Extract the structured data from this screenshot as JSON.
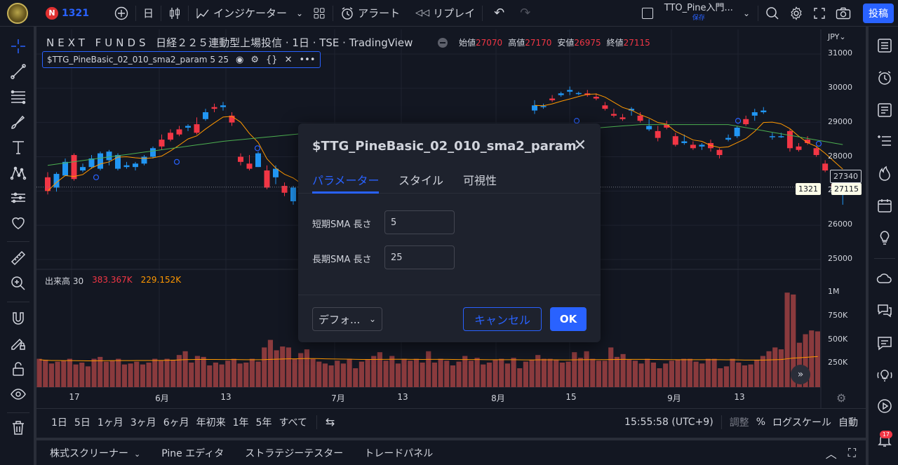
{
  "topbar": {
    "symbol": "1321",
    "interval": "日",
    "indicators_label": "インジケーター",
    "alert_label": "アラート",
    "replay_label": "リプレイ",
    "layout_name": "TTO_Pine入門...",
    "layout_status": "保存",
    "post_label": "投稿"
  },
  "chart": {
    "title_prefix": "NEXT FUNDS",
    "title_rest": "日経２２５連動型上場投信 · 1日 · TSE · TradingView",
    "ohlc": [
      {
        "k": "始値",
        "v": "27070"
      },
      {
        "k": "高値",
        "v": "27170"
      },
      {
        "k": "安値",
        "v": "26975"
      },
      {
        "k": "終値",
        "v": "27115"
      }
    ],
    "indicator_legend": "$TTG_PineBasic_02_010_sma2_param 5 25",
    "currency": "JPY",
    "price_ticks": [
      "31000",
      "30000",
      "29000",
      "28000",
      "27000",
      "26000",
      "25000"
    ],
    "volume_ticks": [
      "1M",
      "750K",
      "500K",
      "250K"
    ],
    "time_ticks": [
      "17",
      "6月",
      "13",
      "7月",
      "13",
      "8月",
      "15",
      "9月",
      "13"
    ],
    "price_label_sma": "27340",
    "price_label_last": "27115",
    "symbol_tag": "1321",
    "volume_legend": {
      "name": "出来高 30",
      "v1": "383.367K",
      "v2": "229.152K"
    }
  },
  "dialog": {
    "title": "$TTG_PineBasic_02_010_sma2_param",
    "tabs": [
      "パラメーター",
      "スタイル",
      "可視性"
    ],
    "active_tab": 0,
    "params": [
      {
        "label": "短期SMA 長さ",
        "value": "5"
      },
      {
        "label": "長期SMA 長さ",
        "value": "25"
      }
    ],
    "defaults_label": "デフォ...",
    "cancel_label": "キャンセル",
    "ok_label": "OK"
  },
  "time_range": {
    "items": [
      "1日",
      "5日",
      "1ヶ月",
      "3ヶ月",
      "6ヶ月",
      "年初来",
      "1年",
      "5年",
      "すべて"
    ],
    "clock": "15:55:58 (UTC+9)",
    "adjust": "調整",
    "percent": "%",
    "log": "ログスケール",
    "auto": "自動"
  },
  "bottom_panel": {
    "items": [
      "株式スクリーナー",
      "Pine エディタ",
      "ストラテジーテスター",
      "トレードパネル"
    ]
  },
  "notifications_count": "17",
  "colors": {
    "up": "#2196f3",
    "down": "#f23645",
    "accent": "#2962ff",
    "sma_short": "#ff9800",
    "sma_long": "#4caf50",
    "volume": "#8a3a3d"
  },
  "chart_data": {
    "type": "candlestick",
    "price_ylim": [
      25000,
      31000
    ],
    "ohlc_series": [
      [
        27400,
        27550,
        26900,
        27000
      ],
      [
        27100,
        27550,
        26980,
        27500
      ],
      [
        27450,
        27950,
        27450,
        27850
      ],
      [
        28050,
        28100,
        27300,
        27350
      ],
      [
        27600,
        27800,
        27550,
        27700
      ],
      [
        27700,
        28050,
        27650,
        27950
      ],
      [
        27650,
        28150,
        27600,
        28100
      ],
      [
        27900,
        28200,
        27750,
        28150
      ],
      [
        27650,
        28100,
        27600,
        28050
      ],
      [
        27700,
        27850,
        27650,
        27750
      ],
      [
        27700,
        27850,
        27600,
        27800
      ],
      [
        27800,
        28050,
        27750,
        28000
      ],
      [
        28000,
        28300,
        27950,
        28250
      ],
      [
        28500,
        28650,
        28200,
        28300
      ],
      [
        28700,
        28800,
        28450,
        28500
      ],
      [
        28800,
        28900,
        28600,
        28650
      ],
      [
        28850,
        28950,
        28750,
        28900
      ],
      [
        28950,
        29150,
        28650,
        28700
      ],
      [
        29100,
        29400,
        29050,
        29300
      ],
      [
        29450,
        29550,
        29300,
        29400
      ],
      [
        29450,
        29600,
        29350,
        29500
      ],
      [
        29200,
        29300,
        28900,
        29000
      ],
      [
        28000,
        28100,
        27750,
        27850
      ],
      [
        27800,
        28050,
        27600,
        27650
      ],
      [
        27700,
        28150,
        27700,
        28100
      ],
      [
        27600,
        27750,
        27050,
        27100
      ],
      [
        27400,
        27750,
        27200,
        27650
      ],
      [
        27150,
        27250,
        26850,
        26950
      ],
      [
        26700,
        27150,
        26600,
        27100
      ],
      [
        26950,
        27250,
        26900,
        27200
      ],
      [
        27050,
        27150,
        26900,
        27000
      ],
      [
        27200,
        27350,
        26950,
        27050
      ],
      [
        27250,
        27500,
        27150,
        27400
      ]
    ],
    "ohlc_series_right": [
      [
        29350,
        29650,
        29250,
        29500
      ],
      [
        29450,
        29550,
        29400,
        29480
      ],
      [
        29700,
        29800,
        29600,
        29650
      ],
      [
        29800,
        29900,
        29750,
        29850
      ],
      [
        29900,
        30050,
        29800,
        29950
      ],
      [
        29850,
        29900,
        29800,
        29860
      ],
      [
        29850,
        29950,
        29750,
        29800
      ],
      [
        29750,
        29850,
        29650,
        29700
      ],
      [
        29500,
        29600,
        29350,
        29400
      ],
      [
        29250,
        29400,
        29150,
        29200
      ],
      [
        29150,
        29250,
        29050,
        29100
      ],
      [
        29350,
        29450,
        29200,
        29400
      ],
      [
        29200,
        29300,
        29000,
        29050
      ],
      [
        28800,
        29100,
        28750,
        28900
      ],
      [
        28750,
        28900,
        28450,
        28550
      ],
      [
        28950,
        29050,
        28800,
        28850
      ],
      [
        28600,
        28700,
        28300,
        28350
      ],
      [
        28400,
        28650,
        28350,
        28450
      ],
      [
        28350,
        28450,
        28200,
        28250
      ],
      [
        28300,
        28400,
        28200,
        28350
      ],
      [
        28400,
        28500,
        28150,
        28250
      ],
      [
        28200,
        28250,
        27950,
        28050
      ],
      [
        28500,
        28650,
        28450,
        28550
      ],
      [
        28600,
        28900,
        28550,
        28850
      ],
      [
        29100,
        29200,
        28900,
        28950
      ],
      [
        29200,
        29400,
        29050,
        29300
      ],
      [
        29300,
        29450,
        29250,
        29350
      ],
      [
        28600,
        28700,
        28500,
        28600
      ],
      [
        28600,
        28700,
        28550,
        28600
      ],
      [
        28750,
        28800,
        28150,
        28250
      ],
      [
        28300,
        28400,
        28150,
        28200
      ],
      [
        28500,
        28600,
        28350,
        28400
      ],
      [
        28250,
        28300,
        28000,
        28050
      ],
      [
        27800,
        27900,
        27550,
        27600
      ],
      [
        27200,
        27400,
        27000,
        27100
      ],
      [
        26950,
        27150,
        26600,
        27050
      ]
    ],
    "volume_ylim": [
      0,
      1150000
    ],
    "volumes": [
      300,
      290,
      250,
      270,
      280,
      300,
      240,
      260,
      220,
      300,
      320,
      270,
      280,
      300,
      240,
      250,
      270,
      240,
      260,
      300,
      280,
      300,
      290,
      340,
      380,
      260,
      330,
      320,
      230,
      260,
      240,
      280,
      300,
      250,
      260,
      300,
      270,
      420,
      500,
      390,
      430,
      420,
      300,
      360,
      400,
      300,
      270,
      250,
      230,
      280,
      250,
      300,
      200,
      270,
      290,
      330,
      370,
      280,
      330,
      250,
      300,
      280,
      300,
      260,
      380,
      260,
      300,
      280,
      230,
      270,
      330,
      280,
      310,
      240,
      260,
      290,
      300,
      250,
      310,
      200,
      270,
      290,
      340,
      300,
      300,
      290,
      260,
      270,
      370,
      310,
      380,
      300,
      280,
      280,
      420,
      320,
      350,
      290,
      280,
      250,
      300,
      260,
      200,
      250,
      280,
      290,
      300,
      300,
      270,
      250,
      300,
      300,
      200,
      220,
      300,
      260,
      230,
      240,
      290,
      330,
      380,
      420,
      400,
      1000,
      980,
      470,
      560,
      600,
      590
    ],
    "volume_ma": [
      290,
      285,
      282,
      282,
      281,
      281,
      280,
      279,
      278,
      278,
      279,
      280,
      281,
      281,
      281,
      281,
      282,
      282,
      282,
      282,
      283,
      284,
      286,
      288,
      291,
      292,
      293,
      294,
      293,
      293,
      292,
      292,
      292,
      291,
      290,
      290,
      290,
      291,
      294,
      296,
      298,
      300,
      300,
      301,
      302,
      302,
      301,
      300,
      299,
      298,
      297,
      296,
      294,
      293,
      293,
      293,
      294,
      294,
      295,
      295,
      295,
      294,
      294,
      293,
      294,
      294,
      294,
      294,
      293,
      292,
      292,
      292,
      292,
      291,
      290,
      290,
      290,
      290,
      290,
      289,
      288,
      288,
      289,
      289,
      289,
      289,
      288,
      288,
      289,
      290,
      291,
      291,
      291,
      291,
      292,
      293,
      294,
      294,
      294,
      294,
      294,
      293,
      292,
      291,
      291,
      290,
      290,
      290,
      290,
      290,
      290,
      290,
      290,
      289,
      289,
      288,
      287,
      287,
      287,
      287,
      288,
      290,
      292,
      300,
      308,
      311,
      315,
      320,
      324
    ]
  }
}
